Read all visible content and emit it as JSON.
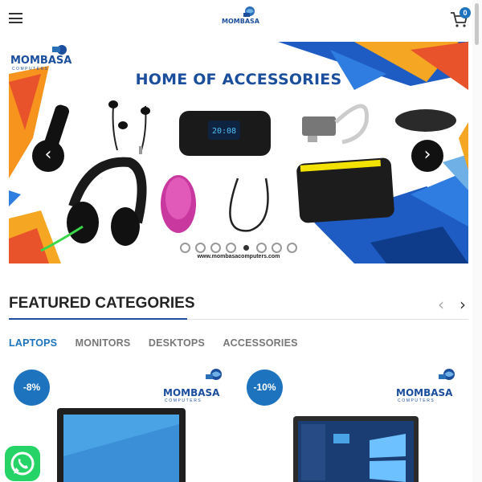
{
  "header": {
    "menu_icon": "hamburger-menu-icon",
    "logo_text": "MOMBASA",
    "logo_sub": "COMPUTERS",
    "cart_icon": "shopping-cart-icon",
    "cart_count": "0"
  },
  "banner": {
    "title": "HOME OF ACCESSORIES",
    "logo_text": "MOMBASA",
    "logo_sub": "COMPUTERS",
    "url": "www.mombasacomputers.com",
    "prev_icon": "chevron-left-icon",
    "next_icon": "chevron-right-icon",
    "prev_glyph": "‹",
    "next_glyph": "›",
    "clock_text": "20:08",
    "slide_count": 8,
    "active_slide": 5
  },
  "featured": {
    "title": "FEATURED CATEGORIES",
    "prev_glyph": "‹",
    "next_glyph": "›",
    "tabs": [
      "LAPTOPS",
      "MONITORS",
      "DESKTOPS",
      "ACCESSORIES"
    ],
    "active_tab": 0
  },
  "products": [
    {
      "badge": "-8%",
      "logo_text": "MOMBASA",
      "logo_sub": "COMPUTERS"
    },
    {
      "badge": "-10%",
      "logo_text": "MOMBASA",
      "logo_sub": "COMPUTERS"
    }
  ],
  "colors": {
    "accent": "#1e73be",
    "banner_title": "#1b4e9c",
    "whatsapp": "#25d366"
  }
}
